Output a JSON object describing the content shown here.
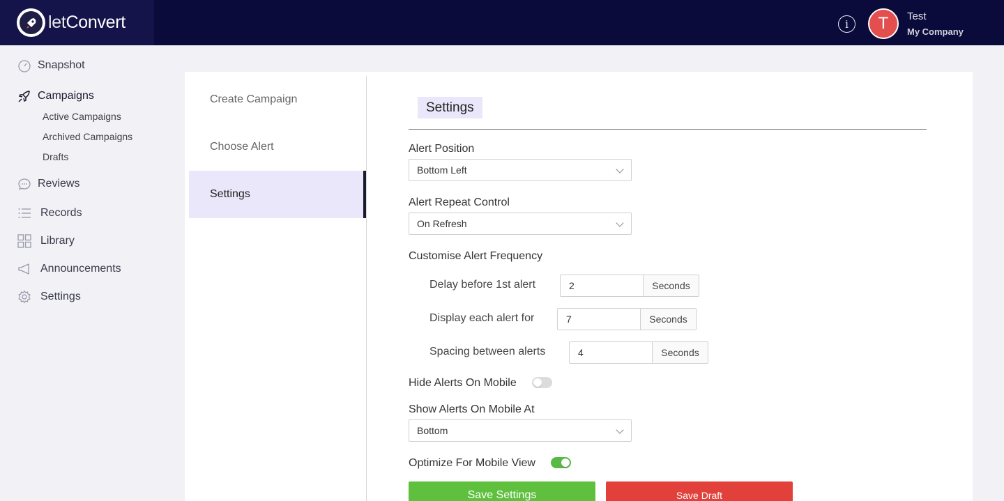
{
  "brand": {
    "name_light": "let",
    "name_bold": "Convert"
  },
  "header": {
    "user_name": "Test",
    "user_company": "My Company",
    "avatar_letter": "T"
  },
  "sidebar": {
    "items": [
      {
        "label": "Snapshot",
        "icon": "gauge-icon"
      },
      {
        "label": "Campaigns",
        "icon": "rocket-icon"
      },
      {
        "label": "Reviews",
        "icon": "chat-bubble-icon"
      },
      {
        "label": "Records",
        "icon": "list-icon"
      },
      {
        "label": "Library",
        "icon": "grid-icon"
      },
      {
        "label": "Announcements",
        "icon": "megaphone-icon"
      },
      {
        "label": "Settings",
        "icon": "gear-icon"
      }
    ],
    "campaign_subitems": [
      "Active Campaigns",
      "Archived Campaigns",
      "Drafts"
    ]
  },
  "steps": [
    "Create Campaign",
    "Choose Alert",
    "Settings"
  ],
  "settings": {
    "title": "Settings",
    "alert_position": {
      "label": "Alert Position",
      "value": "Bottom Left"
    },
    "alert_repeat": {
      "label": "Alert Repeat Control",
      "value": "On Refresh"
    },
    "frequency": {
      "label": "Customise Alert Frequency",
      "unit": "Seconds",
      "delay": {
        "label": "Delay before 1st alert",
        "value": "2"
      },
      "display": {
        "label": "Display each alert for",
        "value": "7"
      },
      "spacing": {
        "label": "Spacing between alerts",
        "value": "4"
      }
    },
    "hide_mobile": {
      "label": "Hide Alerts On Mobile",
      "enabled": false
    },
    "show_mobile_at": {
      "label": "Show Alerts On Mobile At",
      "value": "Bottom"
    },
    "optimize_mobile": {
      "label": "Optimize For Mobile View",
      "enabled": true
    },
    "save_settings": "Save Settings",
    "save_draft": "Save Draft"
  },
  "colors": {
    "topbar": "#0b0b3b",
    "accent": "#e9e7f9",
    "green": "#5ec03d",
    "red": "#e1413a",
    "avatar": "#e34e4e"
  }
}
